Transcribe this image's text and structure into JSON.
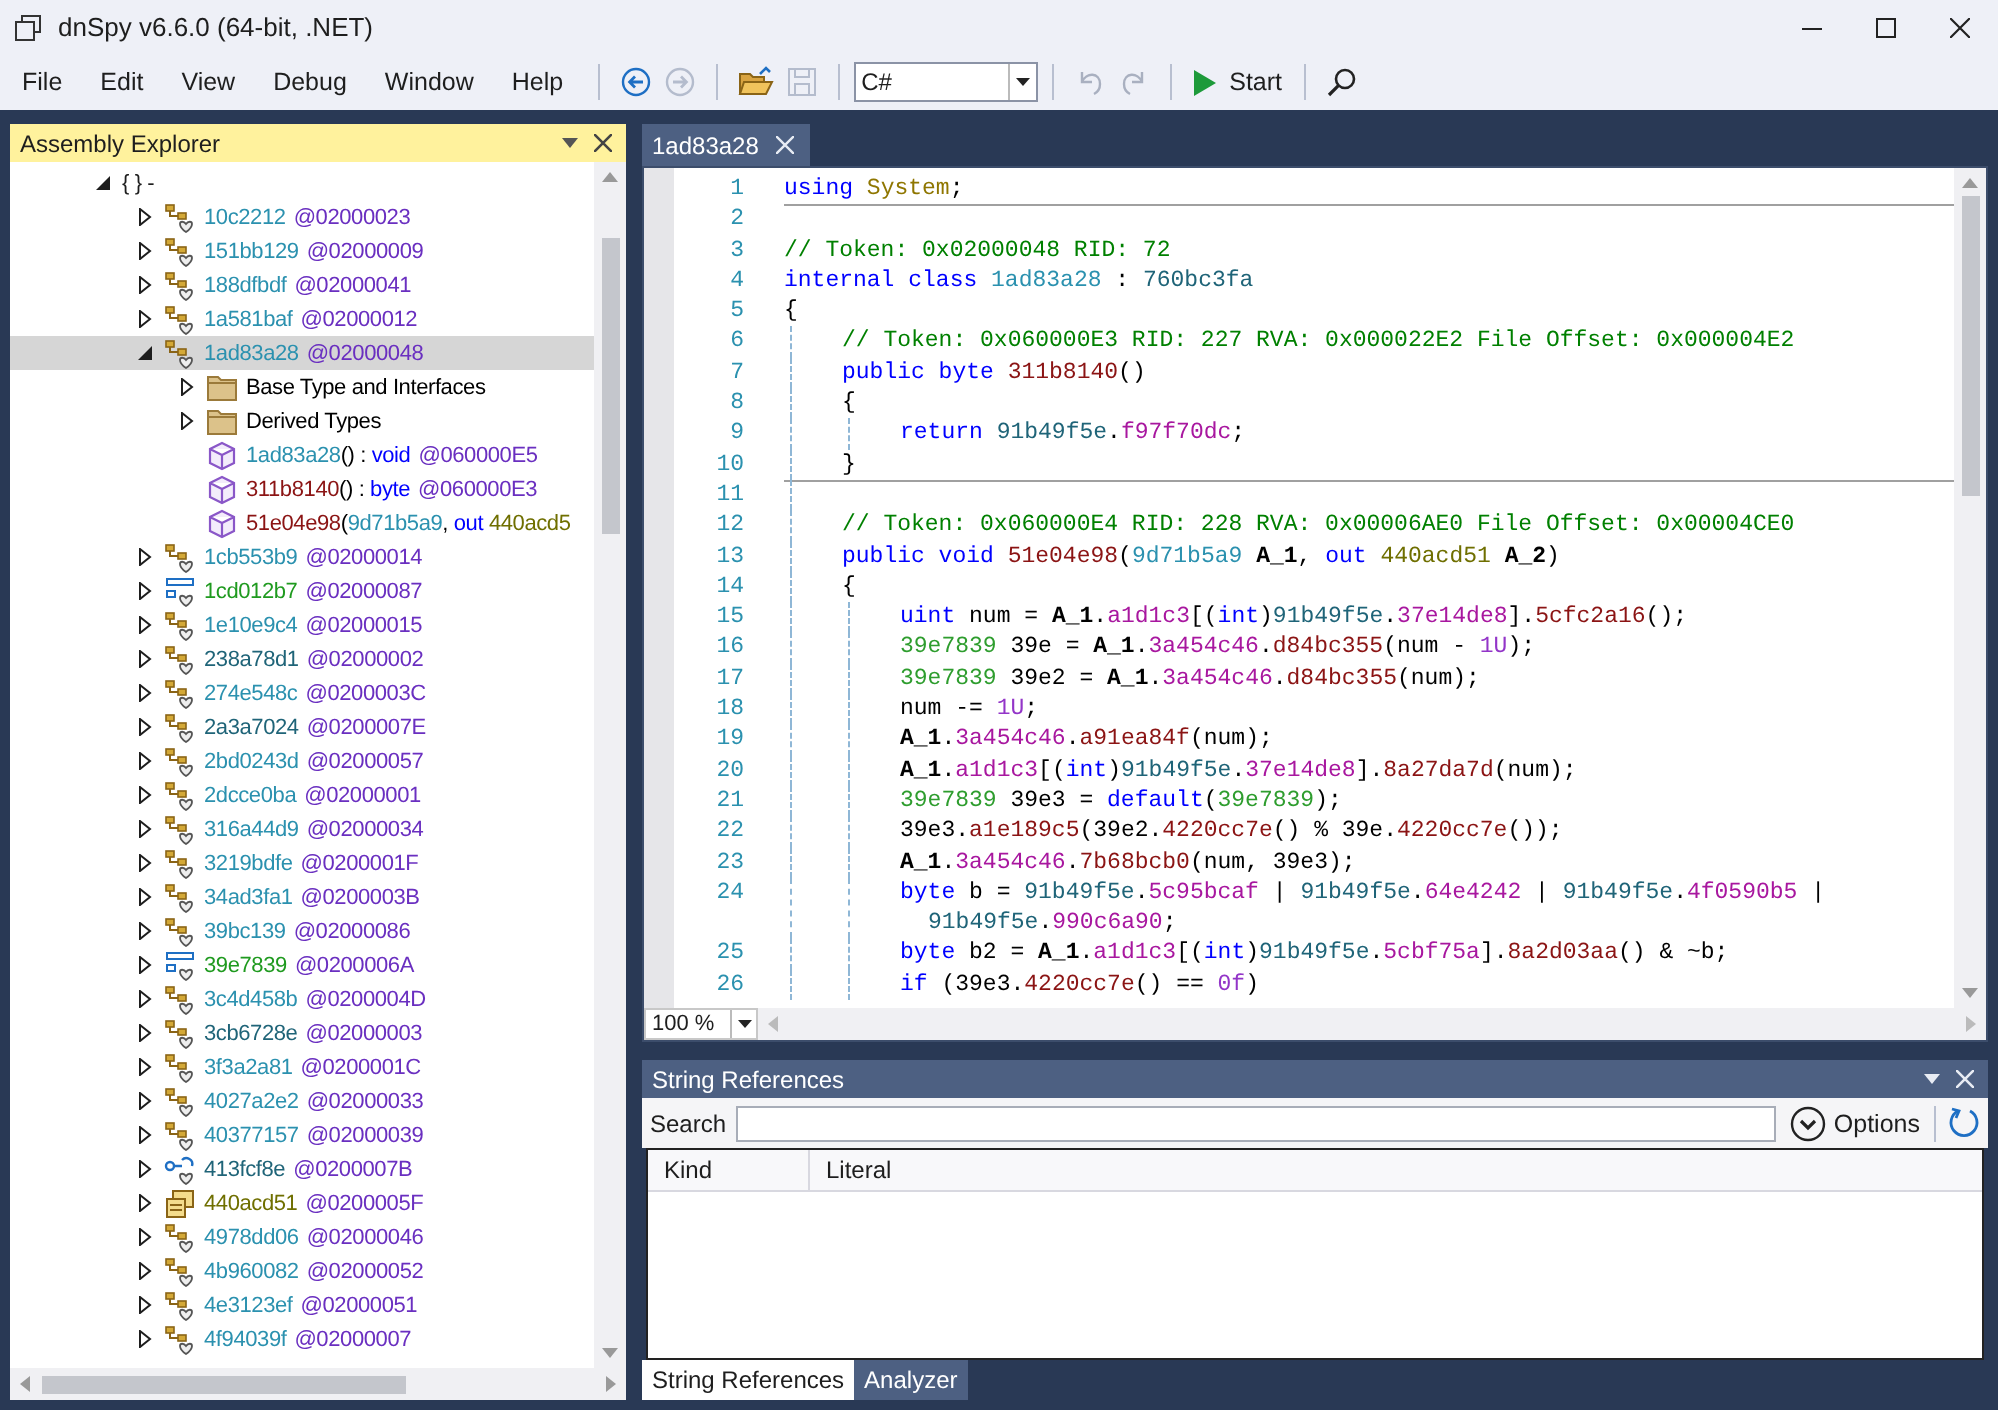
{
  "window": {
    "title": "dnSpy v6.6.0 (64-bit, .NET)"
  },
  "menu": [
    "File",
    "Edit",
    "View",
    "Debug",
    "Window",
    "Help"
  ],
  "toolbar": [
    {
      "kind": "separator"
    },
    {
      "kind": "back",
      "disabled": false
    },
    {
      "kind": "forward",
      "disabled": true
    },
    {
      "kind": "separator"
    },
    {
      "kind": "open",
      "disabled": false
    },
    {
      "kind": "save",
      "disabled": true
    },
    {
      "kind": "separator"
    },
    {
      "kind": "combo",
      "value": "C#"
    },
    {
      "kind": "separator"
    },
    {
      "kind": "undo",
      "disabled": true
    },
    {
      "kind": "redo",
      "disabled": true
    },
    {
      "kind": "separator"
    },
    {
      "kind": "start",
      "label": "Start",
      "disabled": false
    },
    {
      "kind": "separator"
    },
    {
      "kind": "search",
      "disabled": false
    }
  ],
  "assembly_explorer": {
    "title": "Assembly Explorer",
    "tree": {
      "label": "{ } -",
      "expanded": true,
      "selected": false,
      "children": [
        {
          "kind": "class",
          "name": "10c2212",
          "token": "@02000023",
          "expanded": false,
          "selected": false
        },
        {
          "kind": "class",
          "name": "151bb129",
          "token": "@02000009",
          "expanded": false,
          "selected": false
        },
        {
          "kind": "class",
          "name": "188dfbdf",
          "token": "@02000041",
          "expanded": false,
          "selected": false
        },
        {
          "kind": "class",
          "name": "1a581baf",
          "token": "@02000012",
          "expanded": false,
          "selected": false
        },
        {
          "kind": "class",
          "name": "1ad83a28",
          "token": "@02000048",
          "expanded": true,
          "selected": true,
          "children": [
            {
              "kind": "folder",
              "name": "Base Type and Interfaces",
              "expanded": false,
              "selected": false
            },
            {
              "kind": "folder",
              "name": "Derived Types",
              "expanded": false,
              "selected": false
            },
            {
              "kind": "method",
              "segments": [
                {
                  "kind": "type",
                  "text": "1ad83a28"
                },
                {
                  "kind": "plain",
                  "text": "() : "
                },
                {
                  "kind": "keyword",
                  "text": "void"
                }
              ],
              "token": "@060000E5",
              "selected": false
            },
            {
              "kind": "method",
              "segments": [
                {
                  "kind": "method",
                  "text": "311b8140"
                },
                {
                  "kind": "plain",
                  "text": "() : "
                },
                {
                  "kind": "keyword",
                  "text": "byte"
                }
              ],
              "token": "@060000E3",
              "selected": false
            },
            {
              "kind": "method",
              "segments": [
                {
                  "kind": "method",
                  "text": "51e04e98"
                },
                {
                  "kind": "plain",
                  "text": "("
                },
                {
                  "kind": "type",
                  "text": "9d71b5a9"
                },
                {
                  "kind": "plain",
                  "text": ", "
                },
                {
                  "kind": "keyword",
                  "text": "out "
                },
                {
                  "kind": "delegate",
                  "text": "440acd5"
                }
              ],
              "selected": false
            }
          ]
        },
        {
          "kind": "class",
          "name": "1cb553b9",
          "token": "@02000014",
          "expanded": false,
          "selected": false
        },
        {
          "kind": "struct",
          "name": "1cd012b7",
          "token": "@02000087",
          "expanded": false,
          "selected": false
        },
        {
          "kind": "class",
          "name": "1e10e9c4",
          "token": "@02000015",
          "expanded": false,
          "selected": false
        },
        {
          "kind": "static_class",
          "name": "238a78d1",
          "token": "@02000002",
          "expanded": false,
          "selected": false
        },
        {
          "kind": "class",
          "name": "274e548c",
          "token": "@0200003C",
          "expanded": false,
          "selected": false
        },
        {
          "kind": "static_class",
          "name": "2a3a7024",
          "token": "@0200007E",
          "expanded": false,
          "selected": false
        },
        {
          "kind": "class",
          "name": "2bd0243d",
          "token": "@02000057",
          "expanded": false,
          "selected": false
        },
        {
          "kind": "class",
          "name": "2dcce0ba",
          "token": "@02000001",
          "expanded": false,
          "selected": false
        },
        {
          "kind": "class",
          "name": "316a44d9",
          "token": "@02000034",
          "expanded": false,
          "selected": false
        },
        {
          "kind": "class",
          "name": "3219bdfe",
          "token": "@0200001F",
          "expanded": false,
          "selected": false
        },
        {
          "kind": "class",
          "name": "34ad3fa1",
          "token": "@0200003B",
          "expanded": false,
          "selected": false
        },
        {
          "kind": "class",
          "name": "39bc139",
          "token": "@02000086",
          "expanded": false,
          "selected": false
        },
        {
          "kind": "struct",
          "name": "39e7839",
          "token": "@0200006A",
          "expanded": false,
          "selected": false
        },
        {
          "kind": "class",
          "name": "3c4d458b",
          "token": "@0200004D",
          "expanded": false,
          "selected": false
        },
        {
          "kind": "static_class",
          "name": "3cb6728e",
          "token": "@02000003",
          "expanded": false,
          "selected": false
        },
        {
          "kind": "class",
          "name": "3f3a2a81",
          "token": "@0200001C",
          "expanded": false,
          "selected": false
        },
        {
          "kind": "class",
          "name": "4027a2e2",
          "token": "@02000033",
          "expanded": false,
          "selected": false
        },
        {
          "kind": "class",
          "name": "40377157",
          "token": "@02000039",
          "expanded": false,
          "selected": false
        },
        {
          "kind": "interface",
          "name": "413fcf8e",
          "token": "@0200007B",
          "expanded": false,
          "selected": false
        },
        {
          "kind": "delegate",
          "name": "440acd51",
          "token": "@0200005F",
          "expanded": false,
          "selected": false
        },
        {
          "kind": "class",
          "name": "4978dd06",
          "token": "@02000046",
          "expanded": false,
          "selected": false
        },
        {
          "kind": "class",
          "name": "4b960082",
          "token": "@02000052",
          "expanded": false,
          "selected": false
        },
        {
          "kind": "class",
          "name": "4e3123ef",
          "token": "@02000051",
          "expanded": false,
          "selected": false
        },
        {
          "kind": "class",
          "name": "4f94039f",
          "token": "@02000007",
          "expanded": false,
          "selected": false
        }
      ]
    }
  },
  "editor": {
    "tabs": [
      {
        "label": "1ad83a28",
        "selected": true
      }
    ],
    "lines": [
      {
        "number": "1",
        "separator": true,
        "segments": [
          {
            "kind": "keyword",
            "text": "using "
          },
          {
            "kind": "namespace",
            "text": "System"
          },
          {
            "kind": "plain",
            "text": ";"
          }
        ]
      },
      {
        "number": "2"
      },
      {
        "number": "3",
        "segments": [
          {
            "kind": "comment",
            "text": "// Token: 0x02000048 RID: 72"
          }
        ]
      },
      {
        "number": "4",
        "segments": [
          {
            "kind": "keyword",
            "text": "internal class "
          },
          {
            "kind": "type",
            "text": "1ad83a28"
          },
          {
            "kind": "plain",
            "text": " : "
          },
          {
            "kind": "static_type",
            "text": "760bc3fa"
          }
        ]
      },
      {
        "number": "5",
        "segments": [
          {
            "kind": "plain",
            "text": "{"
          }
        ],
        "children": [
          {
            "number": "6",
            "segments": [
              {
                "kind": "comment",
                "text": "// Token: 0x060000E3 RID: 227 RVA: 0x000022E2 File Offset: 0x000004E2"
              }
            ]
          },
          {
            "number": "7",
            "segments": [
              {
                "kind": "keyword",
                "text": "public byte "
              },
              {
                "kind": "method",
                "text": "311b8140"
              },
              {
                "kind": "plain",
                "text": "()"
              }
            ]
          },
          {
            "number": "8",
            "segments": [
              {
                "kind": "plain",
                "text": "{"
              }
            ],
            "children": [
              {
                "number": "9",
                "segments": [
                  {
                    "kind": "keyword",
                    "text": "return "
                  },
                  {
                    "kind": "static_type",
                    "text": "91b49f5e"
                  },
                  {
                    "kind": "plain",
                    "text": "."
                  },
                  {
                    "kind": "field",
                    "text": "f97f70dc"
                  },
                  {
                    "kind": "plain",
                    "text": ";"
                  }
                ]
              }
            ]
          },
          {
            "number": "10",
            "separator": true,
            "segments": [
              {
                "kind": "plain",
                "text": "}"
              }
            ]
          },
          {
            "number": "11"
          },
          {
            "number": "12",
            "segments": [
              {
                "kind": "comment",
                "text": "// Token: 0x060000E4 RID: 228 RVA: 0x00006AE0 File Offset: 0x00004CE0"
              }
            ]
          },
          {
            "number": "13",
            "segments": [
              {
                "kind": "keyword",
                "text": "public void "
              },
              {
                "kind": "method",
                "text": "51e04e98"
              },
              {
                "kind": "plain",
                "text": "("
              },
              {
                "kind": "type",
                "text": "9d71b5a9"
              },
              {
                "kind": "param",
                "text": " A_1"
              },
              {
                "kind": "plain",
                "text": ", "
              },
              {
                "kind": "keyword",
                "text": "out "
              },
              {
                "kind": "delegate",
                "text": "440acd51"
              },
              {
                "kind": "param",
                "text": " A_2"
              },
              {
                "kind": "plain",
                "text": ")"
              }
            ]
          },
          {
            "number": "14",
            "segments": [
              {
                "kind": "plain",
                "text": "{"
              }
            ],
            "children": [
              {
                "number": "15",
                "segments": [
                  {
                    "kind": "keyword",
                    "text": "uint "
                  },
                  {
                    "kind": "plain",
                    "text": "num = "
                  },
                  {
                    "kind": "param",
                    "text": "A_1"
                  },
                  {
                    "kind": "plain",
                    "text": "."
                  },
                  {
                    "kind": "field",
                    "text": "a1d1c3"
                  },
                  {
                    "kind": "plain",
                    "text": "[("
                  },
                  {
                    "kind": "keyword",
                    "text": "int"
                  },
                  {
                    "kind": "plain",
                    "text": ")"
                  },
                  {
                    "kind": "static_type",
                    "text": "91b49f5e"
                  },
                  {
                    "kind": "plain",
                    "text": "."
                  },
                  {
                    "kind": "field",
                    "text": "37e14de8"
                  },
                  {
                    "kind": "plain",
                    "text": "]."
                  },
                  {
                    "kind": "method",
                    "text": "5cfc2a16"
                  },
                  {
                    "kind": "plain",
                    "text": "();"
                  }
                ]
              },
              {
                "number": "16",
                "segments": [
                  {
                    "kind": "struct",
                    "text": "39e7839"
                  },
                  {
                    "kind": "plain",
                    "text": " 39e = "
                  },
                  {
                    "kind": "param",
                    "text": "A_1"
                  },
                  {
                    "kind": "plain",
                    "text": "."
                  },
                  {
                    "kind": "field",
                    "text": "3a454c46"
                  },
                  {
                    "kind": "plain",
                    "text": "."
                  },
                  {
                    "kind": "method",
                    "text": "d84bc355"
                  },
                  {
                    "kind": "plain",
                    "text": "(num - "
                  },
                  {
                    "kind": "number",
                    "text": "1U"
                  },
                  {
                    "kind": "plain",
                    "text": ");"
                  }
                ]
              },
              {
                "number": "17",
                "segments": [
                  {
                    "kind": "struct",
                    "text": "39e7839"
                  },
                  {
                    "kind": "plain",
                    "text": " 39e2 = "
                  },
                  {
                    "kind": "param",
                    "text": "A_1"
                  },
                  {
                    "kind": "plain",
                    "text": "."
                  },
                  {
                    "kind": "field",
                    "text": "3a454c46"
                  },
                  {
                    "kind": "plain",
                    "text": "."
                  },
                  {
                    "kind": "method",
                    "text": "d84bc355"
                  },
                  {
                    "kind": "plain",
                    "text": "(num);"
                  }
                ]
              },
              {
                "number": "18",
                "segments": [
                  {
                    "kind": "plain",
                    "text": "num -= "
                  },
                  {
                    "kind": "number",
                    "text": "1U"
                  },
                  {
                    "kind": "plain",
                    "text": ";"
                  }
                ]
              },
              {
                "number": "19",
                "segments": [
                  {
                    "kind": "param",
                    "text": "A_1"
                  },
                  {
                    "kind": "plain",
                    "text": "."
                  },
                  {
                    "kind": "field",
                    "text": "3a454c46"
                  },
                  {
                    "kind": "plain",
                    "text": "."
                  },
                  {
                    "kind": "method",
                    "text": "a91ea84f"
                  },
                  {
                    "kind": "plain",
                    "text": "(num);"
                  }
                ]
              },
              {
                "number": "20",
                "segments": [
                  {
                    "kind": "param",
                    "text": "A_1"
                  },
                  {
                    "kind": "plain",
                    "text": "."
                  },
                  {
                    "kind": "field",
                    "text": "a1d1c3"
                  },
                  {
                    "kind": "plain",
                    "text": "[("
                  },
                  {
                    "kind": "keyword",
                    "text": "int"
                  },
                  {
                    "kind": "plain",
                    "text": ")"
                  },
                  {
                    "kind": "static_type",
                    "text": "91b49f5e"
                  },
                  {
                    "kind": "plain",
                    "text": "."
                  },
                  {
                    "kind": "field",
                    "text": "37e14de8"
                  },
                  {
                    "kind": "plain",
                    "text": "]."
                  },
                  {
                    "kind": "method",
                    "text": "8a27da7d"
                  },
                  {
                    "kind": "plain",
                    "text": "(num);"
                  }
                ]
              },
              {
                "number": "21",
                "segments": [
                  {
                    "kind": "struct",
                    "text": "39e7839"
                  },
                  {
                    "kind": "plain",
                    "text": " 39e3 = "
                  },
                  {
                    "kind": "keyword",
                    "text": "default"
                  },
                  {
                    "kind": "plain",
                    "text": "("
                  },
                  {
                    "kind": "struct",
                    "text": "39e7839"
                  },
                  {
                    "kind": "plain",
                    "text": ");"
                  }
                ]
              },
              {
                "number": "22",
                "segments": [
                  {
                    "kind": "plain",
                    "text": "39e3."
                  },
                  {
                    "kind": "method",
                    "text": "a1e189c5"
                  },
                  {
                    "kind": "plain",
                    "text": "(39e2."
                  },
                  {
                    "kind": "method",
                    "text": "4220cc7e"
                  },
                  {
                    "kind": "plain",
                    "text": "() % 39e."
                  },
                  {
                    "kind": "method",
                    "text": "4220cc7e"
                  },
                  {
                    "kind": "plain",
                    "text": "());"
                  }
                ]
              },
              {
                "number": "23",
                "segments": [
                  {
                    "kind": "param",
                    "text": "A_1"
                  },
                  {
                    "kind": "plain",
                    "text": "."
                  },
                  {
                    "kind": "field",
                    "text": "3a454c46"
                  },
                  {
                    "kind": "plain",
                    "text": "."
                  },
                  {
                    "kind": "method",
                    "text": "7b68bcb0"
                  },
                  {
                    "kind": "plain",
                    "text": "(num, 39e3);"
                  }
                ]
              },
              {
                "number": "24",
                "segments": [
                  {
                    "kind": "keyword",
                    "text": "byte "
                  },
                  {
                    "kind": "plain",
                    "text": "b = "
                  },
                  {
                    "kind": "static_type",
                    "text": "91b49f5e"
                  },
                  {
                    "kind": "plain",
                    "text": "."
                  },
                  {
                    "kind": "field",
                    "text": "5c95bcaf"
                  },
                  {
                    "kind": "plain",
                    "text": " | "
                  },
                  {
                    "kind": "static_type",
                    "text": "91b49f5e"
                  },
                  {
                    "kind": "plain",
                    "text": "."
                  },
                  {
                    "kind": "field",
                    "text": "64e4242"
                  },
                  {
                    "kind": "plain",
                    "text": " | "
                  },
                  {
                    "kind": "static_type",
                    "text": "91b49f5e"
                  },
                  {
                    "kind": "plain",
                    "text": "."
                  },
                  {
                    "kind": "field",
                    "text": "4f0590b5"
                  },
                  {
                    "kind": "plain",
                    "text": " |"
                  }
                ],
                "wrap": [
                  {
                    "kind": "static_type",
                    "text": "91b49f5e"
                  },
                  {
                    "kind": "plain",
                    "text": "."
                  },
                  {
                    "kind": "field",
                    "text": "990c6a90"
                  },
                  {
                    "kind": "plain",
                    "text": ";"
                  }
                ]
              },
              {
                "number": "25",
                "segments": [
                  {
                    "kind": "keyword",
                    "text": "byte "
                  },
                  {
                    "kind": "plain",
                    "text": "b2 = "
                  },
                  {
                    "kind": "param",
                    "text": "A_1"
                  },
                  {
                    "kind": "plain",
                    "text": "."
                  },
                  {
                    "kind": "field",
                    "text": "a1d1c3"
                  },
                  {
                    "kind": "plain",
                    "text": "[("
                  },
                  {
                    "kind": "keyword",
                    "text": "int"
                  },
                  {
                    "kind": "plain",
                    "text": ")"
                  },
                  {
                    "kind": "static_type",
                    "text": "91b49f5e"
                  },
                  {
                    "kind": "plain",
                    "text": "."
                  },
                  {
                    "kind": "field",
                    "text": "5cbf75a"
                  },
                  {
                    "kind": "plain",
                    "text": "]."
                  },
                  {
                    "kind": "method",
                    "text": "8a2d03aa"
                  },
                  {
                    "kind": "plain",
                    "text": "() & ~b;"
                  }
                ]
              },
              {
                "number": "26",
                "segments": [
                  {
                    "kind": "keyword",
                    "text": "if "
                  },
                  {
                    "kind": "plain",
                    "text": "(39e3."
                  },
                  {
                    "kind": "method",
                    "text": "4220cc7e"
                  },
                  {
                    "kind": "plain",
                    "text": "() == "
                  },
                  {
                    "kind": "number",
                    "text": "0f"
                  },
                  {
                    "kind": "plain",
                    "text": ")"
                  }
                ]
              }
            ]
          }
        ]
      }
    ],
    "zoom": "100 %"
  },
  "string_references": {
    "title": "String References",
    "search_label": "Search",
    "options": "Options",
    "columns": [
      "Kind",
      "Literal"
    ],
    "tabs": [
      {
        "label": "String References",
        "selected": true
      },
      {
        "label": "Analyzer",
        "selected": false
      }
    ]
  }
}
